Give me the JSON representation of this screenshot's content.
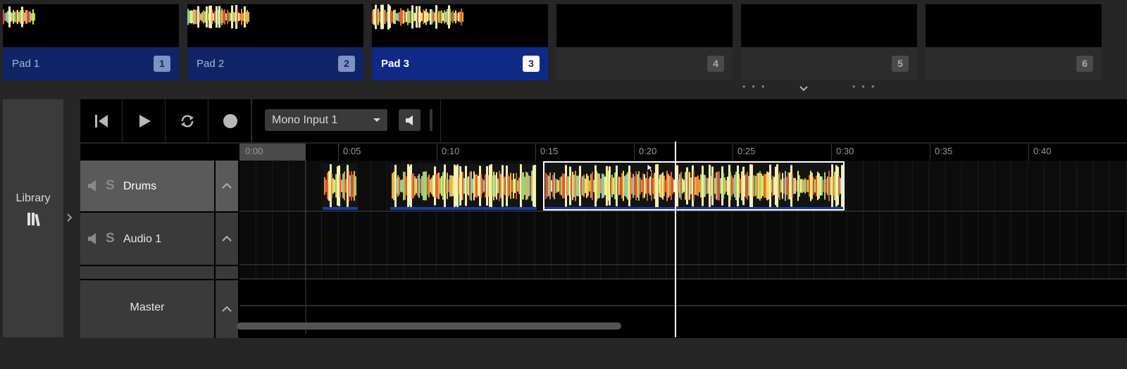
{
  "pads": [
    {
      "label": "Pad 1",
      "number": "1",
      "state": "filled"
    },
    {
      "label": "Pad 2",
      "number": "2",
      "state": "filled"
    },
    {
      "label": "Pad 3",
      "number": "3",
      "state": "active"
    },
    {
      "label": "",
      "number": "4",
      "state": "empty"
    },
    {
      "label": "",
      "number": "5",
      "state": "empty"
    },
    {
      "label": "",
      "number": "6",
      "state": "empty"
    }
  ],
  "pads_more": {
    "dots_left": "• • •",
    "dots_right": "• • •",
    "chevron": "chevron-down-icon"
  },
  "library": {
    "label": "Library",
    "icon": "library-icon"
  },
  "transport": {
    "rewind_icon": "skip-back-icon",
    "play_icon": "play-icon",
    "loop_icon": "loop-icon",
    "record_icon": "record-icon",
    "input_select": "Mono Input 1",
    "monitor_icon": "speaker-icon"
  },
  "ruler": {
    "ticks": [
      "0:00",
      "0:05",
      "0:10",
      "0:15",
      "0:20",
      "0:25",
      "0:30",
      "0:35",
      "0:40"
    ]
  },
  "tracks": [
    {
      "name": "Drums",
      "solo": "S",
      "selected": true
    },
    {
      "name": "Audio 1",
      "solo": "S",
      "selected": false
    }
  ],
  "master": {
    "name": "Master"
  },
  "colors": {
    "accent": "#0f2a86",
    "pad_filled": "#102467",
    "clip_border": "#ffffff",
    "clip_underline": "#1e3ca0"
  }
}
